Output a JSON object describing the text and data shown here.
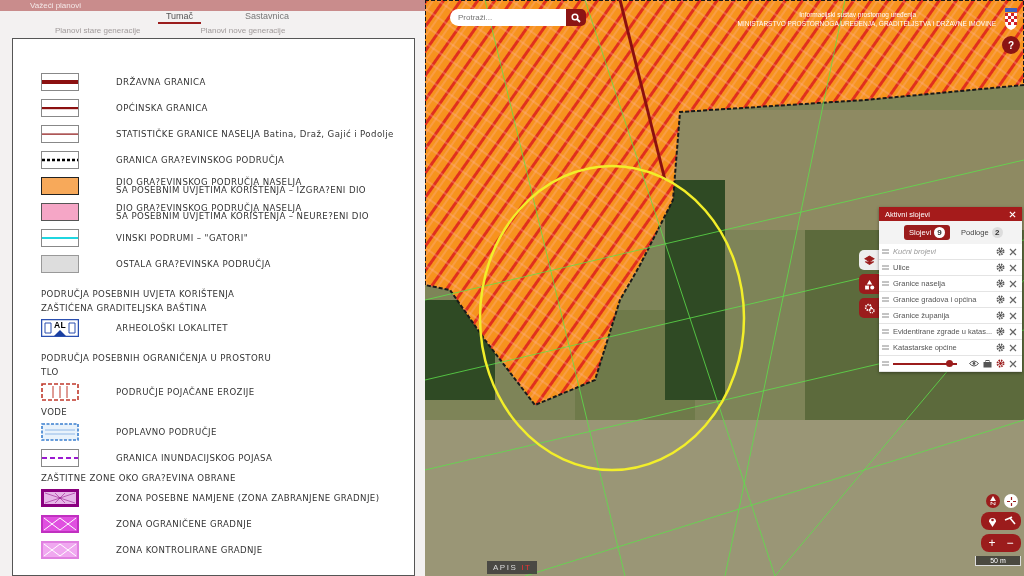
{
  "panel": {
    "title": "Važeći planovi",
    "tabs": [
      {
        "label": "Tumač",
        "selected": true
      },
      {
        "label": "Sastavnica",
        "selected": false
      }
    ],
    "sub_tabs": [
      {
        "label": "Planovi stare generacije"
      },
      {
        "label": "Planovi nove generacije"
      }
    ]
  },
  "legend": [
    {
      "kind": "line-thick",
      "label": "DRŽAVNA GRANICA"
    },
    {
      "kind": "line-medium",
      "label": "OPĆINSKA GRANICA"
    },
    {
      "kind": "line-thin",
      "label": "STATISTIČKE GRANICE NASELJA Batina, Draž, Gajić i Podolje"
    },
    {
      "kind": "dashed-black",
      "label": "GRANICA GRA?EVINSKOG PODRUČJA"
    },
    {
      "kind": "fill-orange",
      "label": "DIO GRA?EVINSKOG PODRUČJA NASELJA\nSA POSEBNIM UVJETIMA KORIŠTENJA – IZGRA?ENI DIO"
    },
    {
      "kind": "fill-pink",
      "label": "DIO GRA?EVINSKOG PODRUČJA NASELJA\nSA POSEBNIM UVJETIMA KORIŠTENJA – NEURE?ENI DIO"
    },
    {
      "kind": "line-cyan",
      "label": "VINSKI PODRUMI – \"GATORI\""
    },
    {
      "kind": "fill-grey",
      "label": "OSTALA GRA?EVINSKA PODRUČJA"
    },
    {
      "kind": "heading",
      "label": "PODRUČJA POSEBNIH UVJETA KORIŠTENJA"
    },
    {
      "kind": "subheading",
      "label": "ZAŠTIĆENA GRADITELJSKA BAŠTINA"
    },
    {
      "kind": "archaeo",
      "swatch_text": "AL",
      "label": "ARHEOLOŠKI LOKALITET"
    },
    {
      "kind": "heading",
      "label": "PODRUČJA POSEBNIH OGRANIČENJA U PROSTORU"
    },
    {
      "kind": "subheading",
      "label": "TLO"
    },
    {
      "kind": "erosion",
      "label": "PODRUČJE POJAČANE EROZIJE"
    },
    {
      "kind": "subheading",
      "label": "VODE"
    },
    {
      "kind": "flood",
      "label": "POPLAVNO PODRUČJE"
    },
    {
      "kind": "dashed-purple",
      "label": "GRANICA INUNDACIJSKOG POJASA"
    },
    {
      "kind": "subheading",
      "label": "ZAŠTITNE ZONE OKO GRA?EVINA OBRANE"
    },
    {
      "kind": "zone-dark",
      "label": "ZONA POSEBNE NAMJENE (ZONA ZABRANJENE GRADNJE)"
    },
    {
      "kind": "zone-magenta",
      "label": "ZONA OGRANIČENE GRADNJE"
    },
    {
      "kind": "zone-light",
      "label": "ZONA KONTROLIRANE GRADNJE"
    }
  ],
  "map": {
    "search": {
      "placeholder": "Protraži..."
    },
    "header": {
      "line_1": "Informacijski sustav prostornog uređenja",
      "line_2": "MINISTARSTVO PROSTORNOGA UREĐENJA, GRADITELJSTVA I DRŽAVNE IMOVINE"
    },
    "help": "?",
    "layers_panel": {
      "title": "Aktivni slojevi",
      "tabs": [
        {
          "label": "Slojevi",
          "count": "9",
          "selected": true
        },
        {
          "label": "Podloge",
          "count": "2",
          "selected": false
        }
      ],
      "layers": [
        {
          "name": "Kućni brojevi",
          "disabled": true
        },
        {
          "name": "Ulice",
          "disabled": false
        },
        {
          "name": "Granice naselja",
          "disabled": false
        },
        {
          "name": "Granice gradova i općina",
          "disabled": false
        },
        {
          "name": "Granice županija",
          "disabled": false
        },
        {
          "name": "Evidentirane zgrade u katas...",
          "disabled": false
        },
        {
          "name": "Katastarske općine",
          "disabled": false
        }
      ],
      "opacity": {
        "level": 0.88
      }
    },
    "zoom_in": "+",
    "zoom_out": "−",
    "scale": "50 m",
    "logo": {
      "name": "APIS",
      "suffix": "IT"
    }
  }
}
